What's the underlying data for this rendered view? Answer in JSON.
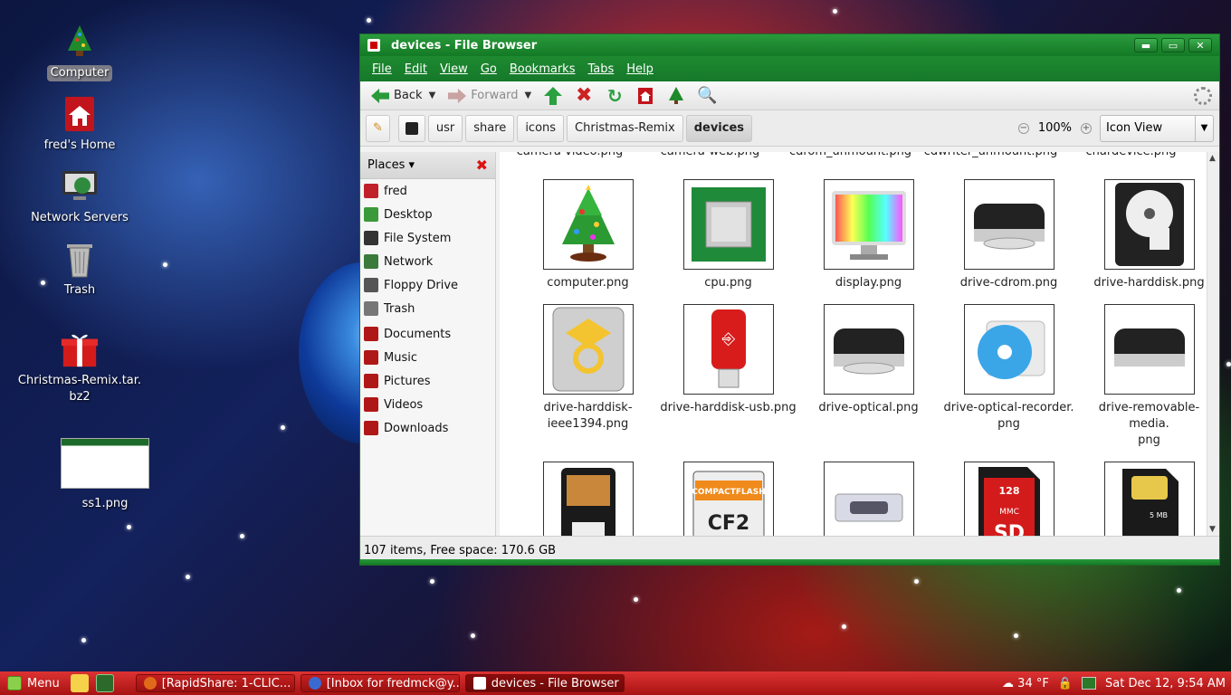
{
  "desktop": {
    "icons": [
      {
        "label": "Computer",
        "icon": "christmas-tree-icon"
      },
      {
        "label": "fred's Home",
        "icon": "home-icon"
      },
      {
        "label": "Network Servers",
        "icon": "network-icon"
      },
      {
        "label": "Trash",
        "icon": "trash-icon"
      },
      {
        "label": "Christmas-Remix.tar.\nbz2",
        "icon": "gift-icon"
      },
      {
        "label": "ss1.png",
        "icon": "image-thumbnail"
      }
    ]
  },
  "window": {
    "title": "devices - File Browser",
    "buttons": {
      "minimize": "▬",
      "maximize": "▭",
      "close": "✕"
    }
  },
  "menubar": [
    "File",
    "Edit",
    "View",
    "Go",
    "Bookmarks",
    "Tabs",
    "Help"
  ],
  "toolbar": {
    "back": "Back",
    "forward": "Forward"
  },
  "location": {
    "crumbs": [
      "usr",
      "share",
      "icons",
      "Christmas-Remix",
      "devices"
    ],
    "zoom": "100%",
    "view": "Icon View"
  },
  "sidebar": {
    "header": "Places",
    "items": [
      {
        "label": "fred",
        "color": "#c0202a"
      },
      {
        "label": "Desktop",
        "color": "#3a9a3a"
      },
      {
        "label": "File System",
        "color": "#333333"
      },
      {
        "label": "Network",
        "color": "#3a7a3a"
      },
      {
        "label": "Floppy Drive",
        "color": "#555555"
      },
      {
        "label": "Trash",
        "color": "#777777"
      },
      {
        "label": "Documents",
        "color": "#b01818"
      },
      {
        "label": "Music",
        "color": "#b01818"
      },
      {
        "label": "Pictures",
        "color": "#b01818"
      },
      {
        "label": "Videos",
        "color": "#b01818"
      },
      {
        "label": "Downloads",
        "color": "#b01818"
      }
    ]
  },
  "files": {
    "partial_top": [
      "camera-video.png",
      "camera-web.png",
      "cdrom_unmount.png",
      "cdwriter_unmount.png",
      "chardevice.png"
    ],
    "items": [
      {
        "name": "computer.png",
        "icon": "christmas-tree-icon"
      },
      {
        "name": "cpu.png",
        "icon": "cpu-chip-icon"
      },
      {
        "name": "display.png",
        "icon": "monitor-icon"
      },
      {
        "name": "drive-cdrom.png",
        "icon": "cdrom-drive-icon"
      },
      {
        "name": "drive-harddisk.png",
        "icon": "harddisk-icon"
      },
      {
        "name": "drive-harddisk-\nieee1394.png",
        "icon": "firewire-drive-icon"
      },
      {
        "name": "drive-harddisk-usb.png",
        "icon": "usb-stick-icon"
      },
      {
        "name": "drive-optical.png",
        "icon": "optical-drive-icon"
      },
      {
        "name": "drive-optical-recorder.\npng",
        "icon": "cd-recorder-icon"
      },
      {
        "name": "drive-removable-media.\npng",
        "icon": "removable-drive-icon"
      },
      {
        "name": "",
        "icon": "floppy-card-icon"
      },
      {
        "name": "",
        "icon": "compactflash-icon"
      },
      {
        "name": "",
        "icon": "memory-stick-icon"
      },
      {
        "name": "",
        "icon": "sd-card-icon"
      },
      {
        "name": "",
        "icon": "sim-card-icon"
      }
    ],
    "cf_text": "COMPACTFLASH",
    "cf_big": "CF2",
    "sd_text": "SD",
    "sd_size": "128",
    "sd_mmc": "MMC",
    "sim_text": "5 MB"
  },
  "status": "107 items, Free space: 170.6 GB",
  "taskbar": {
    "menu": "Menu",
    "tasks": [
      "[RapidShare: 1-CLIC...",
      "[Inbox for fredmck@y...",
      "devices - File Browser"
    ],
    "weather": "34 °F",
    "clock": "Sat Dec 12,  9:54 AM"
  }
}
